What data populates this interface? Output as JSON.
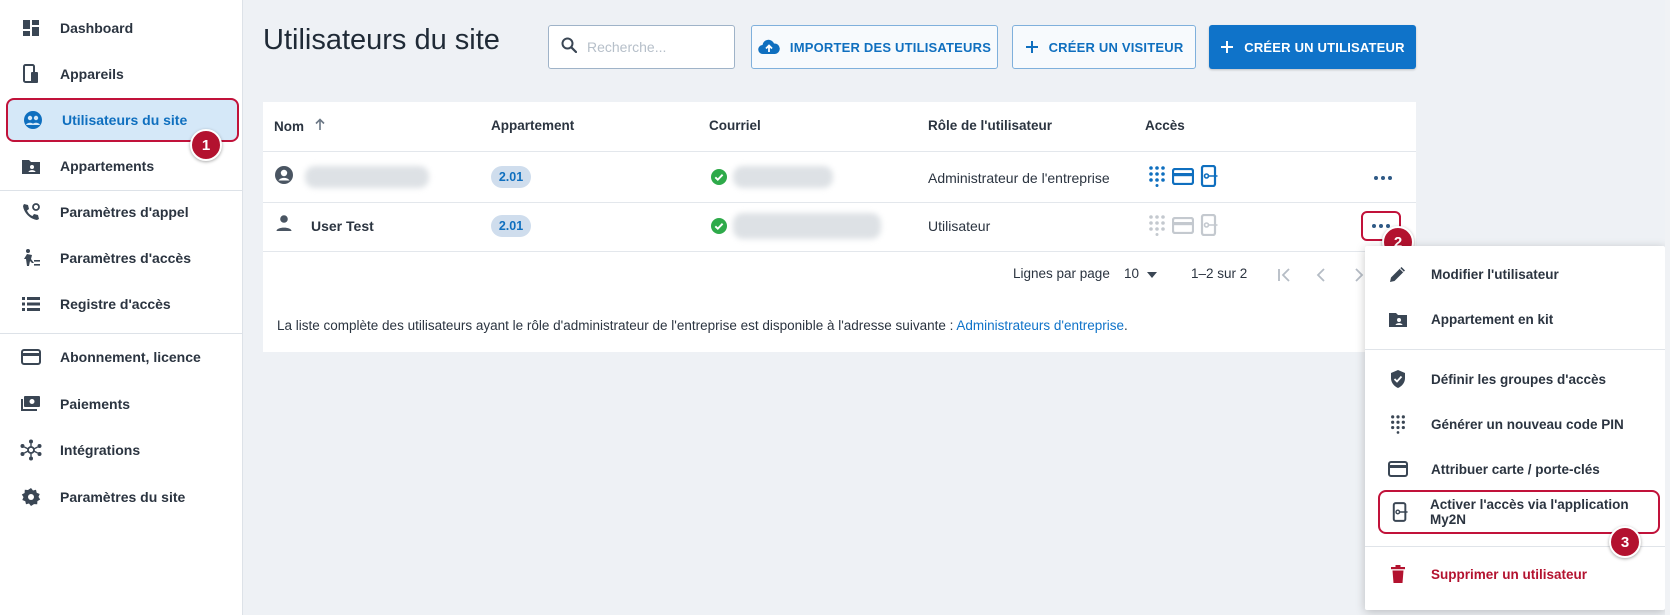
{
  "sidebar": {
    "items": [
      {
        "label": "Dashboard",
        "icon": "dashboard-icon"
      },
      {
        "label": "Appareils",
        "icon": "devices-icon"
      },
      {
        "label": "Utilisateurs du site",
        "icon": "site-users-icon",
        "active": true
      },
      {
        "label": "Appartements",
        "icon": "apartment-icon"
      },
      {
        "label": "Paramètres d'appel",
        "icon": "call-settings-icon"
      },
      {
        "label": "Paramètres d'accès",
        "icon": "access-settings-icon"
      },
      {
        "label": "Registre d'accès",
        "icon": "access-log-icon"
      },
      {
        "label": "Abonnement, licence",
        "icon": "subscription-icon"
      },
      {
        "label": "Paiements",
        "icon": "payments-icon"
      },
      {
        "label": "Intégrations",
        "icon": "integrations-icon"
      },
      {
        "label": "Paramètres du site",
        "icon": "gear-icon"
      }
    ]
  },
  "callouts": [
    "1",
    "2",
    "3"
  ],
  "header": {
    "title": "Utilisateurs du site",
    "search_placeholder": "Recherche...",
    "import_label": "IMPORTER DES UTILISATEURS",
    "create_visitor_label": "CRÉER UN VISITEUR",
    "create_user_label": "CRÉER UN UTILISATEUR"
  },
  "table": {
    "columns": [
      "Nom",
      "Appartement",
      "Courriel",
      "Rôle de l'utilisateur",
      "Accès"
    ],
    "rows": [
      {
        "name": "",
        "apartment": "2.01",
        "role": "Administrateur de l'entreprise",
        "access_active": true
      },
      {
        "name": "User Test",
        "apartment": "2.01",
        "role": "Utilisateur",
        "access_active": false
      }
    ],
    "pagination": {
      "rows_per_page_label": "Lignes par page",
      "rows_per_page_value": "10",
      "range": "1–2 sur 2"
    },
    "footnote_text": "La liste complète des utilisateurs ayant le rôle d'administrateur de l'entreprise est disponible à l'adresse suivante : ",
    "footnote_link": "Administrateurs d'entreprise",
    "footnote_end": "."
  },
  "menu": {
    "items": [
      {
        "label": "Modifier l'utilisateur",
        "icon": "pencil-icon"
      },
      {
        "label": "Appartement en kit",
        "icon": "apartment-kit-icon"
      },
      {
        "label": "Définir les groupes d'accès",
        "icon": "shield-icon"
      },
      {
        "label": "Générer un nouveau code PIN",
        "icon": "keypad-icon"
      },
      {
        "label": "Attribuer carte / porte-clés",
        "icon": "card-icon"
      },
      {
        "label": "Activer l'accès via l'application My2N",
        "icon": "mobile-key-icon"
      },
      {
        "label": "Supprimer un utilisateur",
        "icon": "trash-icon"
      }
    ]
  },
  "colors": {
    "accent": "#0f73c9",
    "highlight": "#c1123a",
    "success": "#2eaa4a",
    "danger": "#b3122f"
  }
}
